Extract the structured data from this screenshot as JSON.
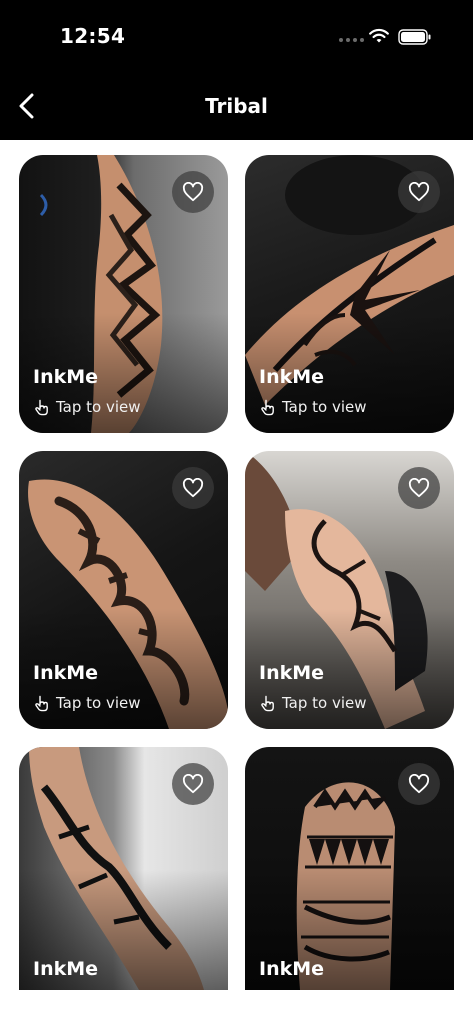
{
  "status_bar": {
    "time": "12:54"
  },
  "nav": {
    "title": "Tribal"
  },
  "cards": [
    {
      "brand": "InkMe",
      "hint": "Tap to view"
    },
    {
      "brand": "InkMe",
      "hint": "Tap to view"
    },
    {
      "brand": "InkMe",
      "hint": "Tap to view"
    },
    {
      "brand": "InkMe",
      "hint": "Tap to view"
    },
    {
      "brand": "InkMe",
      "hint": ""
    },
    {
      "brand": "InkMe",
      "hint": ""
    }
  ],
  "icons": {
    "back": "chevron-left-icon",
    "favorite": "heart-outline-icon",
    "tap": "hand-pointer-icon",
    "wifi": "wifi-icon",
    "battery": "battery-icon"
  },
  "colors": {
    "header_bg": "#000000",
    "page_bg": "#ffffff",
    "text_on_image": "#ffffff"
  }
}
